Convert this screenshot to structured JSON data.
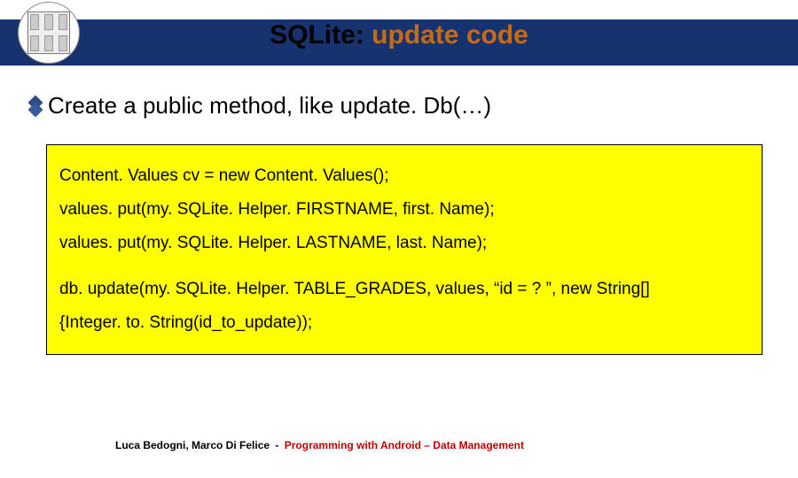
{
  "header": {
    "title_prefix": "SQLite: ",
    "title_accent": "update code"
  },
  "bullet": {
    "text": "Create a public method, like update. Db(…)"
  },
  "code": {
    "line1": "Content. Values cv = new Content. Values();",
    "line2": "values. put(my. SQLite. Helper. FIRSTNAME, first. Name);",
    "line3": "values. put(my. SQLite. Helper. LASTNAME, last. Name);",
    "line4": "db. update(my. SQLite. Helper. TABLE_GRADES, values, “id = ? ”, new  String[]",
    "line5": "{Integer. to. String(id_to_update));"
  },
  "footer": {
    "authors": "Luca Bedogni, Marco Di Felice",
    "dash": "-",
    "course": "Programming with Android – Data Management"
  }
}
